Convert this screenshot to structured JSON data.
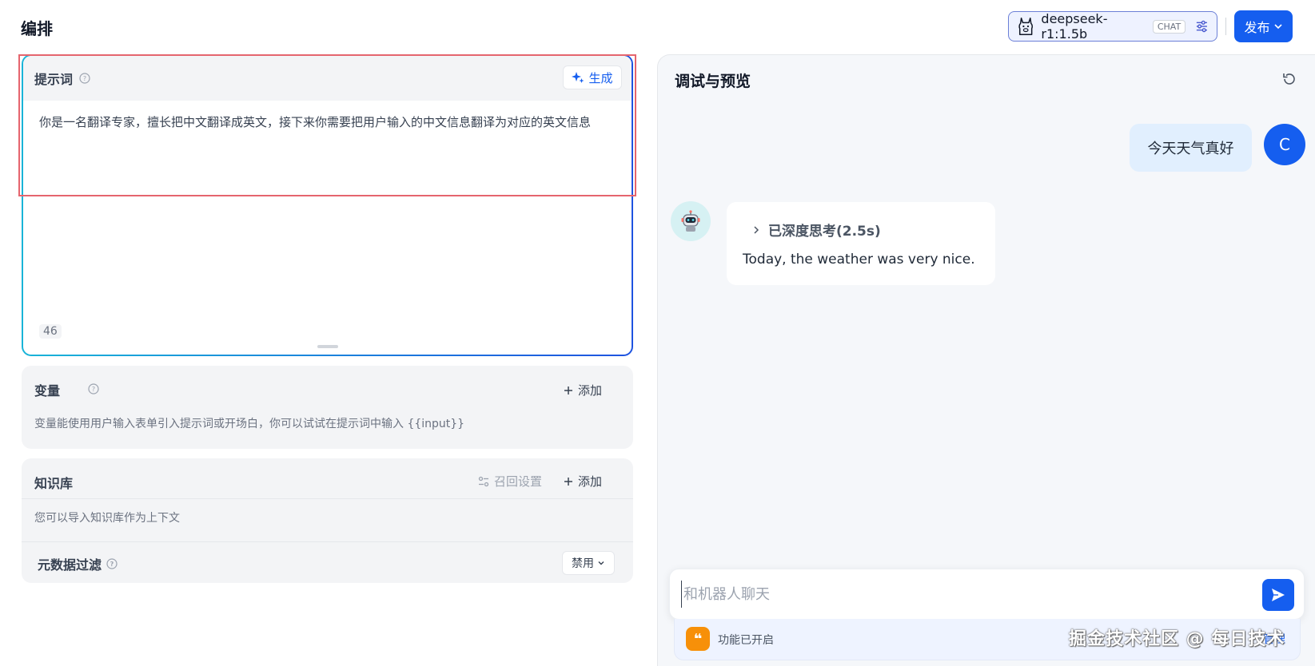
{
  "header": {
    "title": "编排",
    "model_name": "deepseek-r1:1.5b",
    "model_tag": "CHAT",
    "publish_label": "发布"
  },
  "prompt": {
    "label": "提示词",
    "generate_label": "生成",
    "text": "你是一名翻译专家，擅长把中文翻译成英文，接下来你需要把用户输入的中文信息翻译为对应的英文信息",
    "char_count": "46"
  },
  "variables": {
    "label": "变量",
    "add_label": "添加",
    "description": "变量能使用用户输入表单引入提示词或开场白，你可以试试在提示词中输入 {{input}}"
  },
  "knowledge": {
    "label": "知识库",
    "recall_label": "召回设置",
    "add_label": "添加",
    "description": "您可以导入知识库作为上下文",
    "metadata_label": "元数据过滤",
    "metadata_value": "禁用"
  },
  "preview": {
    "title": "调试与预览",
    "user_message": "今天天气真好",
    "user_initial": "C",
    "thinking_label": "已深度思考(2.5s)",
    "bot_reply": "Today, the weather was very nice.",
    "input_placeholder": "和机器人聊天",
    "feature_text": "功能已开启",
    "feature_manage": "管理"
  },
  "watermark": "掘金技术社区 @ 每日技术",
  "colors": {
    "accent": "#155eef",
    "highlight": "#e5656e",
    "feature_icon": "#f79009"
  },
  "icons": {
    "model": "llama-icon",
    "tune": "sliders-icon",
    "generate": "sparkle-icon",
    "help": "question-circle-icon",
    "add": "plus-icon",
    "recall": "settings-toggle-icon",
    "refresh": "refresh-icon",
    "send": "send-icon",
    "chevron": "chevron-down-icon",
    "think": "chevron-right-icon"
  }
}
